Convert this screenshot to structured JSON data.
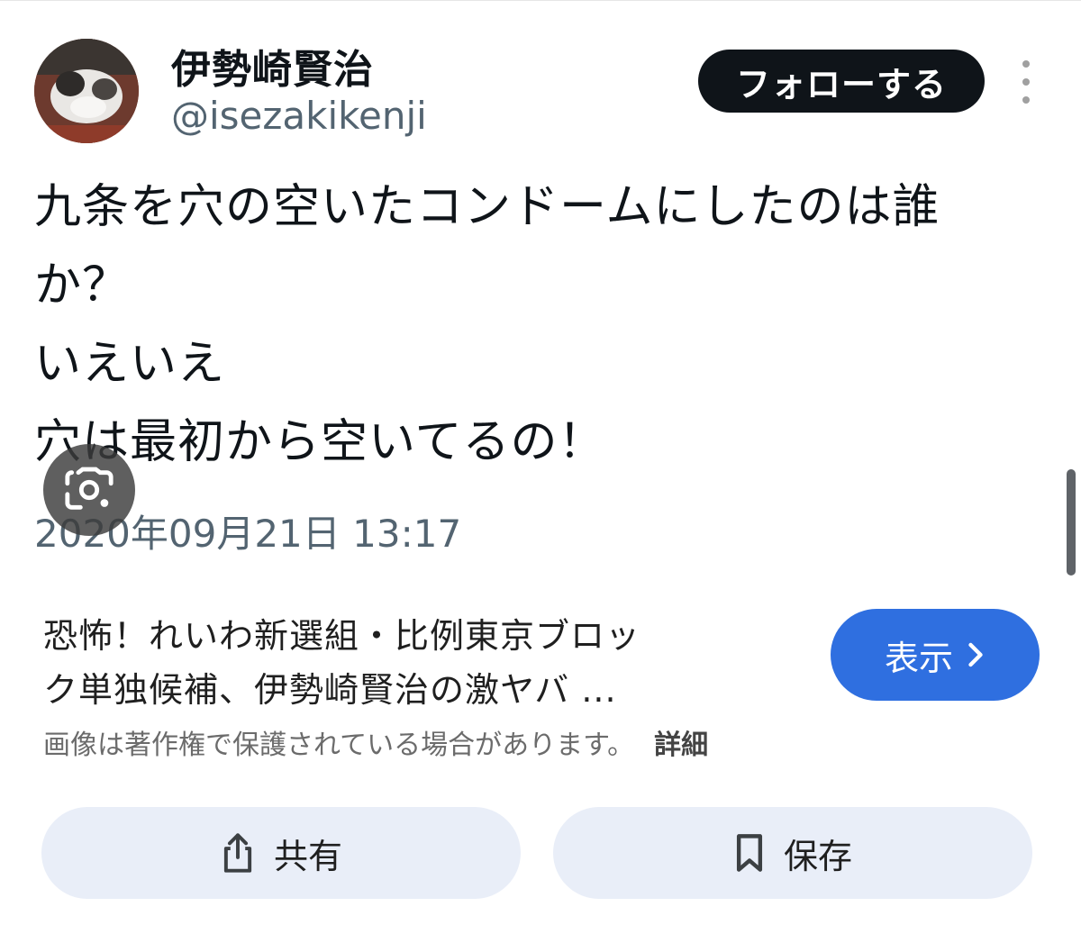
{
  "tweet": {
    "display_name": "伊勢崎賢治",
    "handle": "@isezakikenji",
    "follow_label": "フォローする",
    "text_lines": [
      "九条を穴の空いたコンドームにしたのは誰",
      "か？",
      "いえいえ",
      "穴は最初から空いてるの！"
    ],
    "timestamp": "2020年09月21日 13:17"
  },
  "result": {
    "title_lines": [
      "恐怖！れいわ新選組・比例東京ブロッ",
      "ク単独候補、伊勢崎賢治の激ヤバ ..."
    ],
    "view_label": "表示",
    "copyright_notice": "画像は著作権で保護されている場合があります。",
    "details_label": "詳細"
  },
  "actions": {
    "share_label": "共有",
    "save_label": "保存"
  },
  "icons": {
    "more": "more-vertical-icon",
    "lens": "google-lens-icon",
    "chevron": "chevron-right-icon",
    "share": "share-icon",
    "save": "bookmark-icon"
  },
  "colors": {
    "follow_bg": "#0f1419",
    "view_btn_bg": "#2f6fe0",
    "action_btn_bg": "#e9eef8"
  }
}
